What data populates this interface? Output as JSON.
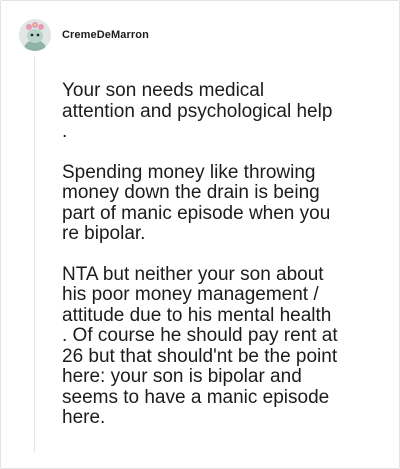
{
  "comment": {
    "author": "CremeDeMarron",
    "avatar_icon": "avatar-snoo-icon",
    "paragraphs": [
      "Your son needs medical\nattention and psychological help\n.",
      "Spending money like throwing\nmoney down the drain is being\npart of manic episode when you\nre bipolar.",
      "NTA but neither your son about\nhis poor money management /\nattitude due to his mental health\n. Of course he should pay rent at\n26 but that should'nt be the point\nhere: your son is bipolar and\nseems to have a manic episode\nhere."
    ]
  },
  "colors": {
    "text": "#1c1c1c",
    "border": "#e3e3e3",
    "background": "#ffffff"
  }
}
